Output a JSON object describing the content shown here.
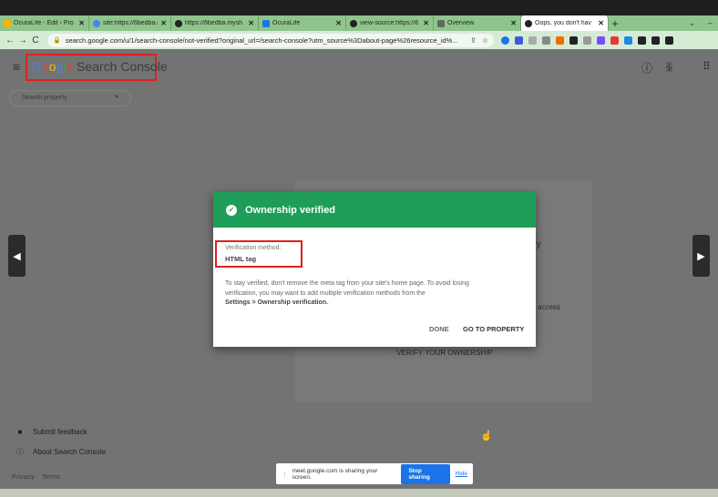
{
  "browser": {
    "tabs": [
      {
        "title": "OcuraLife - Edit ‹ Pro",
        "color": "#f4b400"
      },
      {
        "title": "site:https://6bedba.m",
        "color": "#4285f4"
      },
      {
        "title": "https://6bedba.mysh",
        "color": "#222222"
      },
      {
        "title": "OcuraLife",
        "color": "#1a73e8"
      },
      {
        "title": "view-source:https://6",
        "color": "#222222"
      },
      {
        "title": "Overview",
        "color": "#666666"
      },
      {
        "title": "Oops, you don't hav",
        "color": "#222222",
        "active": true
      }
    ],
    "url": "search.google.com/u/1/search-console/not-verified?original_url=/search-console?utm_source%3Dabout-page%26resource_id%..."
  },
  "header": {
    "logo_google": "Google",
    "logo_product": "Search Console"
  },
  "search_property": {
    "placeholder": "Search property"
  },
  "background": {
    "frag_ty": "ty",
    "frag_access": "access",
    "verify_button": "VERIFY YOUR OWNERSHIP"
  },
  "sidebar": {
    "submit_feedback": "Submit feedback",
    "about": "About Search Console",
    "privacy": "Privacy",
    "terms": "Terms"
  },
  "modal": {
    "title": "Ownership verified",
    "method_label": "Verification method:",
    "method_value": "HTML tag",
    "body_line1": "To stay verified, don't remove the meta tag from your site's home page. To avoid losing",
    "body_line2": "verification, you may want to add multiple verification methods from the",
    "body_line3": "Settings > Ownership verification.",
    "done": "DONE",
    "go": "GO TO PROPERTY",
    "accent": "#1e9d58"
  },
  "share_bar": {
    "text": "meet.google.com is sharing your screen.",
    "stop": "Stop sharing",
    "hide": "Hide"
  }
}
